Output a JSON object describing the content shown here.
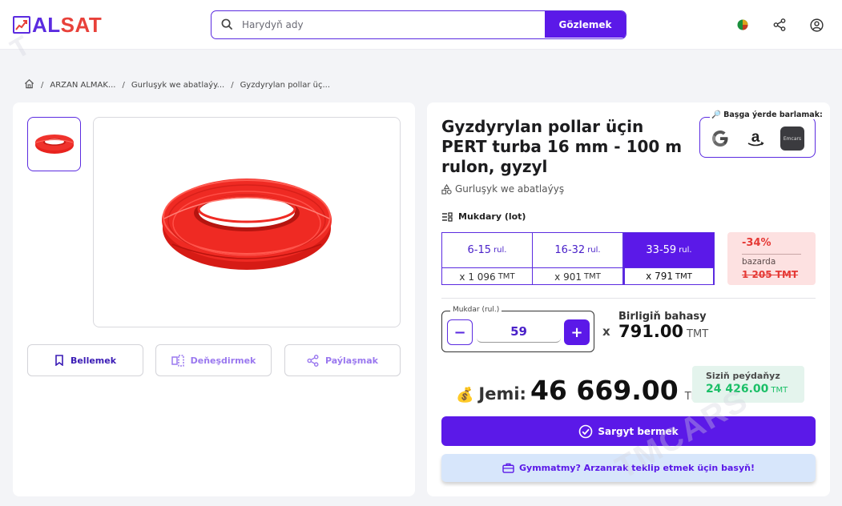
{
  "header": {
    "logo_text_a": "A",
    "logo_text_sat": "LSAT",
    "logo_text_l": "L",
    "search": {
      "placeholder": "Harydyň ady",
      "button_label": "Gözlemek"
    },
    "icons": [
      "pie-chart-icon",
      "share-icon",
      "user-icon"
    ]
  },
  "breadcrumb": {
    "items": [
      "ARZAN ALMAK...",
      "Gurluşyk we abatlaýy...",
      "Gyzdyrylan pollar üç..."
    ],
    "separator": "/"
  },
  "product": {
    "title": "Gyzdyrylan pollar üçin PERT turba 16 mm - 100 m rulon, gyzyl",
    "category": "Gurluşyk we abatlaýyş",
    "compare": {
      "label": "🔎 Başga ýerde barlamak:",
      "sites": [
        "google-logo-icon",
        "amazon-logo-icon",
        "emcars-logo-icon"
      ],
      "emcars_text": "Emcars"
    },
    "actions": {
      "bookmark": "Bellemek",
      "compare": "Deňeşdirmek",
      "share": "Paýlaşmak"
    }
  },
  "quantity": {
    "label": "Mukdary (lot)",
    "unit": "rul.",
    "currency": "TMT",
    "tiers": [
      {
        "range": "6-15",
        "price": "x 1 096",
        "active": false
      },
      {
        "range": "16-32",
        "price": "x 901",
        "active": false
      },
      {
        "range": "33-59",
        "price": "x 791",
        "active": true
      }
    ],
    "discount": {
      "percent": "-34%",
      "label": "bazarda",
      "old_price": "1 205 TMT"
    }
  },
  "stepper": {
    "label": "Mukdar (rul.)",
    "value": "59",
    "minus": "−",
    "plus": "+",
    "times": "x",
    "unit_price_label": "Birligiň bahasy",
    "unit_price": "791.00"
  },
  "totals": {
    "label": "Jemi:",
    "value": "46 669.00",
    "savings_label": "Siziň peýdaňyz",
    "savings_value": "24 426.00"
  },
  "buttons": {
    "order": "Sargyt bermek",
    "offer": "Gymmatmy? Arzanrak teklip etmek üçin basyň!"
  },
  "colors": {
    "accent": "#5b19e8",
    "brand_red": "#e8413a",
    "discount_red": "#e53935",
    "savings_green": "#1bbf67"
  }
}
